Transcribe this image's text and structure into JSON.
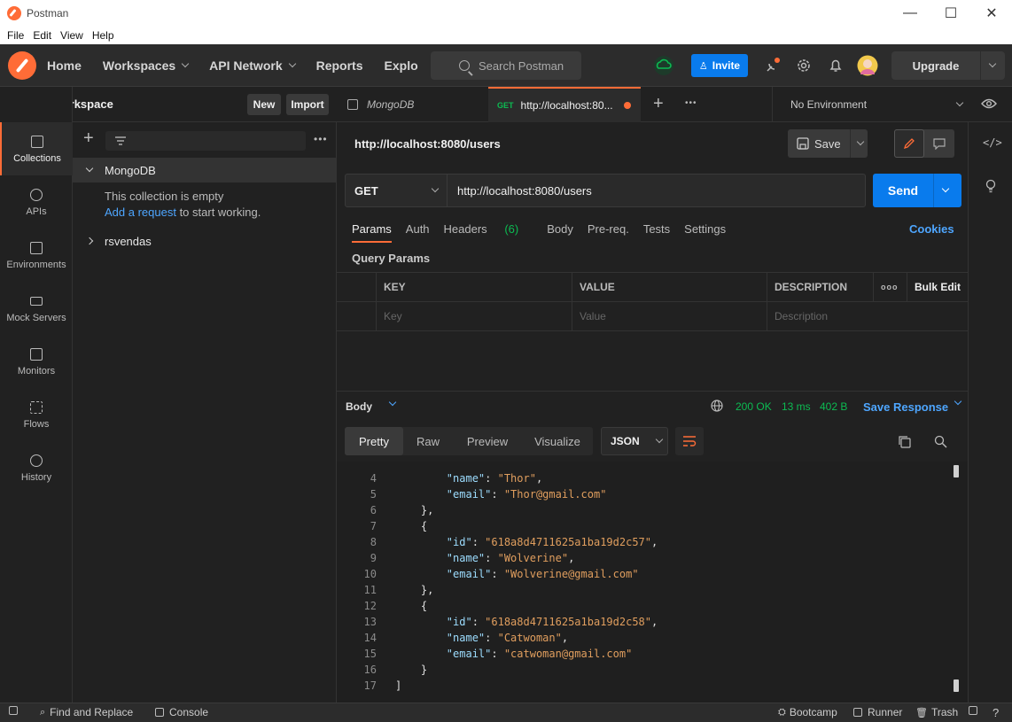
{
  "window": {
    "title": "Postman",
    "minimize": "—",
    "maximize": "☐",
    "close": "✕"
  },
  "menu": [
    "File",
    "Edit",
    "View",
    "Help"
  ],
  "header": {
    "nav": [
      "Home",
      "Workspaces",
      "API Network",
      "Reports",
      "Explo"
    ],
    "search_placeholder": "Search Postman",
    "invite_label": "Invite",
    "upgrade_label": "Upgrade",
    "colors": {
      "brand": "#ff6c37",
      "primary": "#097bed",
      "success": "#0cbb52"
    }
  },
  "workspace": {
    "title": "My Workspace",
    "new_label": "New",
    "import_label": "Import"
  },
  "sidebar": [
    {
      "label": "Collections",
      "icon": "collections-icon",
      "active": true
    },
    {
      "label": "APIs",
      "icon": "apis-icon"
    },
    {
      "label": "Environments",
      "icon": "environments-icon"
    },
    {
      "label": "Mock Servers",
      "icon": "mock-servers-icon"
    },
    {
      "label": "Monitors",
      "icon": "monitors-icon"
    },
    {
      "label": "Flows",
      "icon": "flows-icon"
    },
    {
      "label": "History",
      "icon": "history-icon"
    }
  ],
  "collections": {
    "items": [
      {
        "name": "MongoDB",
        "expanded": true
      },
      {
        "name": "rsvendas",
        "expanded": false
      }
    ],
    "empty_text": "This collection is empty",
    "add_request_link": "Add a request",
    "add_request_suffix": " to start working."
  },
  "tabs": [
    {
      "label": "MongoDB",
      "active": false
    },
    {
      "method": "GET",
      "label": "http://localhost:80...",
      "active": true,
      "unsaved": true
    }
  ],
  "environment": {
    "selected": "No Environment"
  },
  "request": {
    "title": "http://localhost:8080/users",
    "save_label": "Save",
    "method": "GET",
    "url": "http://localhost:8080/users",
    "send_label": "Send",
    "tabs": [
      "Params",
      "Auth",
      "Headers",
      "Body",
      "Pre-req.",
      "Tests",
      "Settings"
    ],
    "headers_count": "(6)",
    "cookies_label": "Cookies",
    "query_params_label": "Query Params",
    "table": {
      "headers": [
        "KEY",
        "VALUE",
        "DESCRIPTION"
      ],
      "bulk_edit": "Bulk Edit",
      "more": "ooo",
      "placeholders": [
        "Key",
        "Value",
        "Description"
      ]
    }
  },
  "response": {
    "body_label": "Body",
    "status": "200 OK",
    "time": "13 ms",
    "size": "402 B",
    "save_response": "Save Response",
    "tabs": [
      "Pretty",
      "Raw",
      "Preview",
      "Visualize"
    ],
    "format": "JSON",
    "lines": [
      {
        "n": "4",
        "indent": 2,
        "key": "name",
        "val": "Thor",
        "comma": true
      },
      {
        "n": "5",
        "indent": 2,
        "key": "email",
        "val": "Thor@gmail.com",
        "comma": false
      },
      {
        "n": "6",
        "indent": 1,
        "text": "},"
      },
      {
        "n": "7",
        "indent": 1,
        "text": "{"
      },
      {
        "n": "8",
        "indent": 2,
        "key": "id",
        "val": "618a8d4711625a1ba19d2c57",
        "comma": true
      },
      {
        "n": "9",
        "indent": 2,
        "key": "name",
        "val": "Wolverine",
        "comma": true
      },
      {
        "n": "10",
        "indent": 2,
        "key": "email",
        "val": "Wolverine@gmail.com",
        "comma": false
      },
      {
        "n": "11",
        "indent": 1,
        "text": "},"
      },
      {
        "n": "12",
        "indent": 1,
        "text": "{"
      },
      {
        "n": "13",
        "indent": 2,
        "key": "id",
        "val": "618a8d4711625a1ba19d2c58",
        "comma": true
      },
      {
        "n": "14",
        "indent": 2,
        "key": "name",
        "val": "Catwoman",
        "comma": true
      },
      {
        "n": "15",
        "indent": 2,
        "key": "email",
        "val": "catwoman@gmail.com",
        "comma": false
      },
      {
        "n": "16",
        "indent": 1,
        "text": "}"
      },
      {
        "n": "17",
        "indent": 0,
        "text": "]"
      }
    ]
  },
  "statusbar": {
    "find_replace": "Find and Replace",
    "console": "Console",
    "bootcamp": "Bootcamp",
    "runner": "Runner",
    "trash": "Trash"
  }
}
